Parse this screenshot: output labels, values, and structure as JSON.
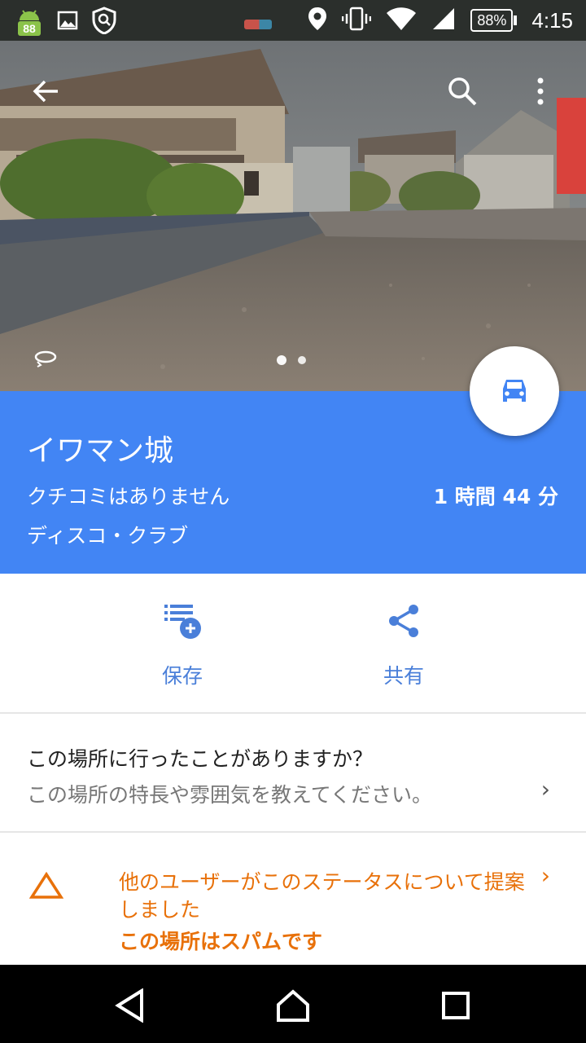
{
  "status_bar": {
    "badge_number": "88",
    "battery_percent": "88%",
    "time": "4:15"
  },
  "place": {
    "name": "イワマン城",
    "reviews": "クチコミはありません",
    "drive_time": "1 時間 44 分",
    "category": "ディスコ・クラブ"
  },
  "actions": {
    "save_label": "保存",
    "share_label": "共有"
  },
  "question": {
    "title": "この場所に行ったことがありますか？",
    "subtitle": "この場所の特長や雰囲気を教えてください。",
    "chevron": "›"
  },
  "warning": {
    "text": "他のユーザーがこのステータスについて提案しました",
    "strong": "この場所はスパムです",
    "chevron": "›"
  },
  "photo_pager": {
    "current": 1,
    "total": 2
  },
  "colors": {
    "accent_blue": "#4285f4",
    "warning_orange": "#e8710a",
    "action_blue": "#4a7fd9"
  },
  "icons": {
    "back": "arrow-back-icon",
    "search": "search-icon",
    "more": "more-vert-icon",
    "directions": "car-icon",
    "save": "playlist-add-icon",
    "share": "share-icon",
    "warning": "warning-triangle-icon"
  }
}
